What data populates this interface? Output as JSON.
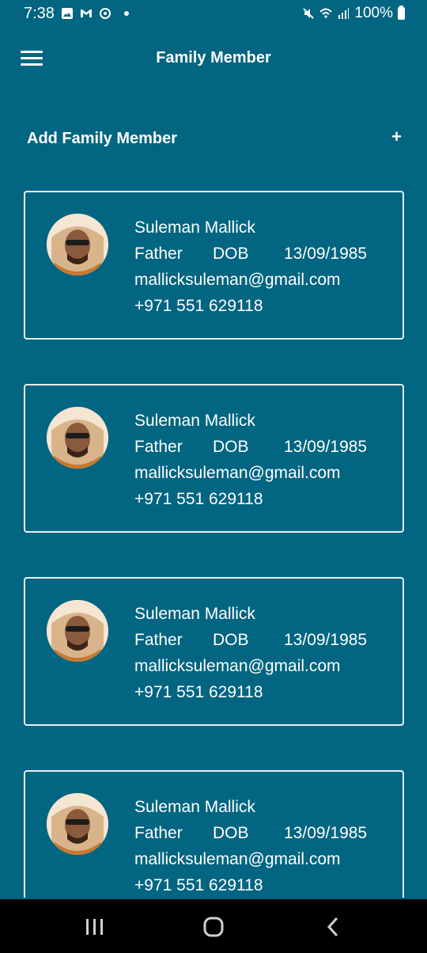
{
  "status": {
    "time": "7:38",
    "battery": "100%",
    "icons": [
      "gallery-icon",
      "gmail-icon",
      "sync-icon",
      "mute-icon",
      "wifi-icon",
      "signal-icon",
      "battery-icon"
    ]
  },
  "app_bar": {
    "title": "Family Member"
  },
  "add_row": {
    "label": "Add Family Member",
    "plus": "+"
  },
  "members": [
    {
      "name": "Suleman Mallick",
      "relation": "Father",
      "dob_label": "DOB",
      "dob": "13/09/1985",
      "email": "mallicksuleman@gmail.com",
      "phone": "+971 551 629118"
    },
    {
      "name": "Suleman Mallick",
      "relation": "Father",
      "dob_label": "DOB",
      "dob": "13/09/1985",
      "email": "mallicksuleman@gmail.com",
      "phone": "+971 551 629118"
    },
    {
      "name": "Suleman Mallick",
      "relation": "Father",
      "dob_label": "DOB",
      "dob": "13/09/1985",
      "email": "mallicksuleman@gmail.com",
      "phone": "+971 551 629118"
    },
    {
      "name": "Suleman Mallick",
      "relation": "Father",
      "dob_label": "DOB",
      "dob": "13/09/1985",
      "email": "mallicksuleman@gmail.com",
      "phone": "+971 551 629118"
    }
  ],
  "colors": {
    "background": "#026581",
    "card_border": "#e8f1f4",
    "nav_bar": "#000000"
  }
}
